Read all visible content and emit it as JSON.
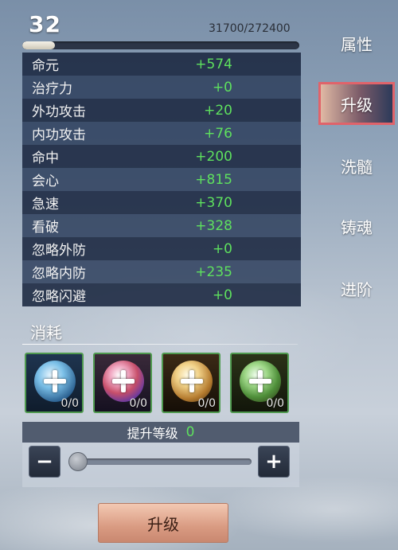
{
  "header": {
    "level": "32",
    "exp_text": "31700/272400",
    "exp_progress": 0.1164
  },
  "stats": [
    {
      "name": "命元",
      "value": "+574"
    },
    {
      "name": "治疗力",
      "value": "+0"
    },
    {
      "name": "外功攻击",
      "value": "+20"
    },
    {
      "name": "内功攻击",
      "value": "+76"
    },
    {
      "name": "命中",
      "value": "+200"
    },
    {
      "name": "会心",
      "value": "+815"
    },
    {
      "name": "急速",
      "value": "+370"
    },
    {
      "name": "看破",
      "value": "+328"
    },
    {
      "name": "忽略外防",
      "value": "+0"
    },
    {
      "name": "忽略内防",
      "value": "+235"
    },
    {
      "name": "忽略闪避",
      "value": "+0"
    }
  ],
  "consume": {
    "title": "消耗",
    "items": [
      {
        "icon": "blue-orb-icon",
        "count": "0/0"
      },
      {
        "icon": "rainbow-orb-icon",
        "count": "0/0"
      },
      {
        "icon": "gold-orb-icon",
        "count": "0/0"
      },
      {
        "icon": "green-orb-icon",
        "count": "0/0"
      }
    ]
  },
  "level_up": {
    "label": "提升等级",
    "value": "0",
    "minus": "−",
    "plus": "+",
    "slider_value": 0
  },
  "upgrade_button": "升级",
  "tabs": [
    {
      "label": "属性"
    },
    {
      "label": "升级",
      "active": true
    },
    {
      "label": "洗髓"
    },
    {
      "label": "铸魂"
    },
    {
      "label": "进阶"
    }
  ],
  "colors": {
    "stat_value": "#5ee05e",
    "active_tab_border": "#e0636a"
  }
}
